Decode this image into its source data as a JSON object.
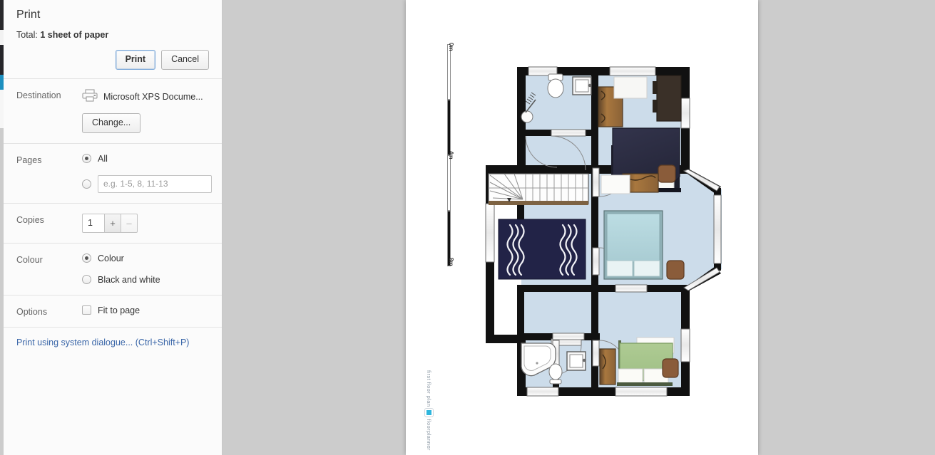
{
  "dialog": {
    "title": "Print",
    "total_label": "Total:",
    "total_value": "1 sheet of paper",
    "print_button": "Print",
    "cancel_button": "Cancel",
    "destination": {
      "label": "Destination",
      "printer_name": "Microsoft XPS Docume...",
      "printer_icon": "printer-icon",
      "change_button": "Change..."
    },
    "pages": {
      "label": "Pages",
      "all_label": "All",
      "all_selected": true,
      "range_selected": false,
      "range_placeholder": "e.g. 1-5, 8, 11-13",
      "range_value": ""
    },
    "copies": {
      "label": "Copies",
      "value": "1",
      "increase": "+",
      "decrease": "–"
    },
    "colour": {
      "label": "Colour",
      "colour_label": "Colour",
      "colour_selected": true,
      "bw_label": "Black and white",
      "bw_selected": false
    },
    "options": {
      "label": "Options",
      "fit_to_page_label": "Fit to page",
      "fit_to_page_checked": false
    },
    "system_dialogue": "Print using system dialogue... (Ctrl+Shift+P)"
  },
  "preview": {
    "scale_bar": {
      "ticks": [
        "0m",
        "4m",
        "8m"
      ]
    },
    "watermark": "floorplanner",
    "floorplan": {
      "title": "first floor plan",
      "floor_color": "#ccdcea",
      "wall_color": "#111111",
      "rooms": [
        {
          "name": "bathroom-upper-left",
          "items": [
            "toilet",
            "washbasin",
            "shower"
          ]
        },
        {
          "name": "landing-hall",
          "items": [
            "staircase",
            "rug"
          ]
        },
        {
          "name": "bedroom-top-right",
          "items": [
            "double-bed-navy",
            "wardrobe",
            "desk",
            "stool"
          ]
        },
        {
          "name": "bedroom-middle-right",
          "items": [
            "double-bed-teal",
            "bay-window",
            "dresser",
            "stool"
          ]
        },
        {
          "name": "bathroom-lower-left",
          "items": [
            "bathtub",
            "toilet",
            "washbasin"
          ]
        },
        {
          "name": "bedroom-bottom-right",
          "items": [
            "double-bed-green",
            "wardrobe",
            "stool"
          ]
        }
      ],
      "colors": {
        "bed_navy": "#2e2f45",
        "bed_teal": "#b5d6dd",
        "bed_green": "#a8c48c",
        "rug_navy": "#222347",
        "wood": "#8a6239",
        "stool_brown": "#8a5c3a"
      }
    }
  }
}
